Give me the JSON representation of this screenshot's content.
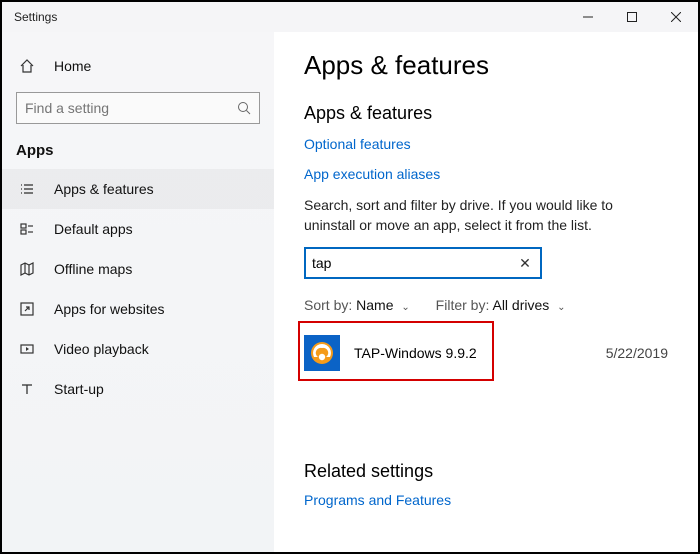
{
  "window": {
    "title": "Settings"
  },
  "sidebar": {
    "home_label": "Home",
    "search_placeholder": "Find a setting",
    "section": "Apps",
    "items": [
      {
        "label": "Apps & features"
      },
      {
        "label": "Default apps"
      },
      {
        "label": "Offline maps"
      },
      {
        "label": "Apps for websites"
      },
      {
        "label": "Video playback"
      },
      {
        "label": "Start-up"
      }
    ]
  },
  "content": {
    "page_title": "Apps & features",
    "subhead1": "Apps & features",
    "link_optional": "Optional features",
    "link_aliases": "App execution aliases",
    "description": "Search, sort and filter by drive. If you would like to uninstall or move an app, select it from the list.",
    "filter_value": "tap",
    "sort_label": "Sort by:",
    "sort_value": "Name",
    "filter_label": "Filter by:",
    "filterby_value": "All drives",
    "app": {
      "name": "TAP-Windows 9.9.2",
      "date": "5/22/2019"
    },
    "related_head": "Related settings",
    "related_link": "Programs and Features"
  }
}
